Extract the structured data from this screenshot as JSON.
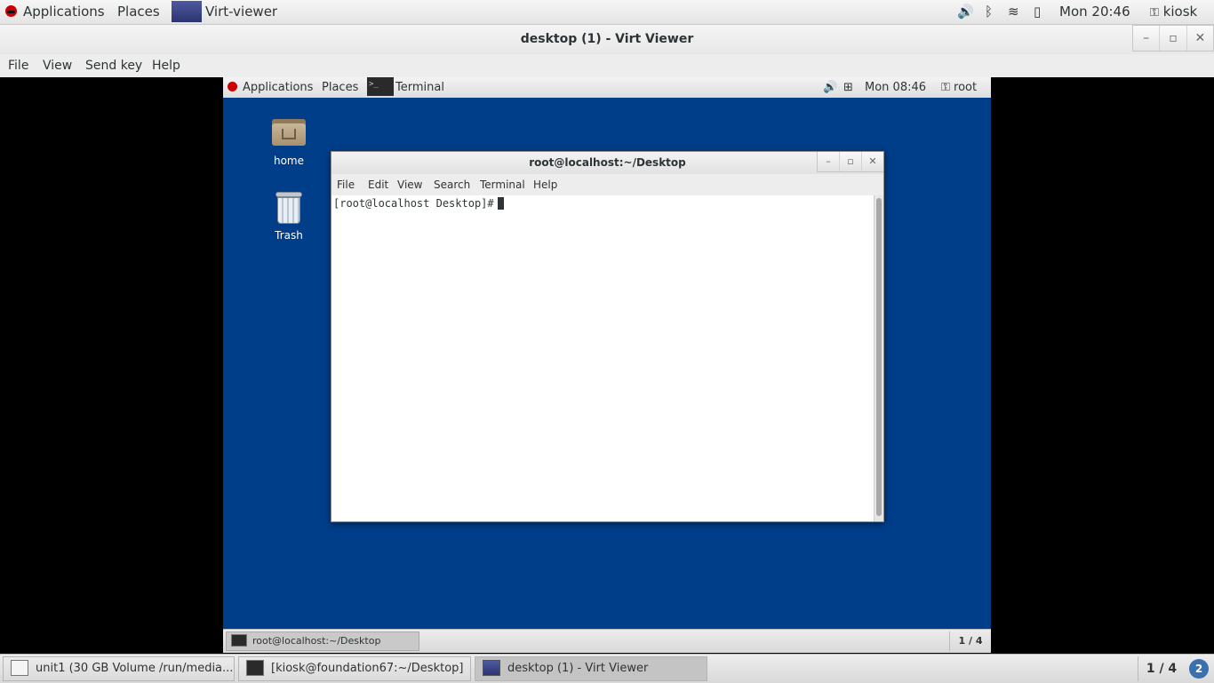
{
  "host_top": {
    "applications": "Applications",
    "places": "Places",
    "active_app": "Virt-viewer",
    "clock": "Mon 20:46",
    "user": "kiosk",
    "icons": [
      "volume-icon",
      "bluetooth-icon",
      "wifi-icon",
      "battery-icon",
      "user-icon"
    ]
  },
  "window": {
    "title": "desktop (1) - Virt Viewer",
    "menu": [
      "File",
      "View",
      "Send key",
      "Help"
    ]
  },
  "guest": {
    "top": {
      "applications": "Applications",
      "places": "Places",
      "active_app": "Terminal",
      "clock": "Mon 08:46",
      "user": "root"
    },
    "desktop_icons": [
      "home",
      "Trash"
    ],
    "terminal": {
      "title": "root@localhost:~/Desktop",
      "menu": [
        "File",
        "Edit",
        "View",
        "Search",
        "Terminal",
        "Help"
      ],
      "prompt": "[root@localhost Desktop]#"
    },
    "bottom": {
      "task": "root@localhost:~/Desktop",
      "workspace": "1 / 4"
    }
  },
  "host_bottom": {
    "tasks": [
      {
        "label": "unit1 (30 GB Volume /run/media...",
        "icon": "text-editor-icon"
      },
      {
        "label": "[kiosk@foundation67:~/Desktop]",
        "icon": "terminal-icon"
      },
      {
        "label": "desktop (1) - Virt Viewer",
        "icon": "virt-viewer-icon"
      }
    ],
    "workspace": "1 / 4",
    "notification_count": "2"
  }
}
